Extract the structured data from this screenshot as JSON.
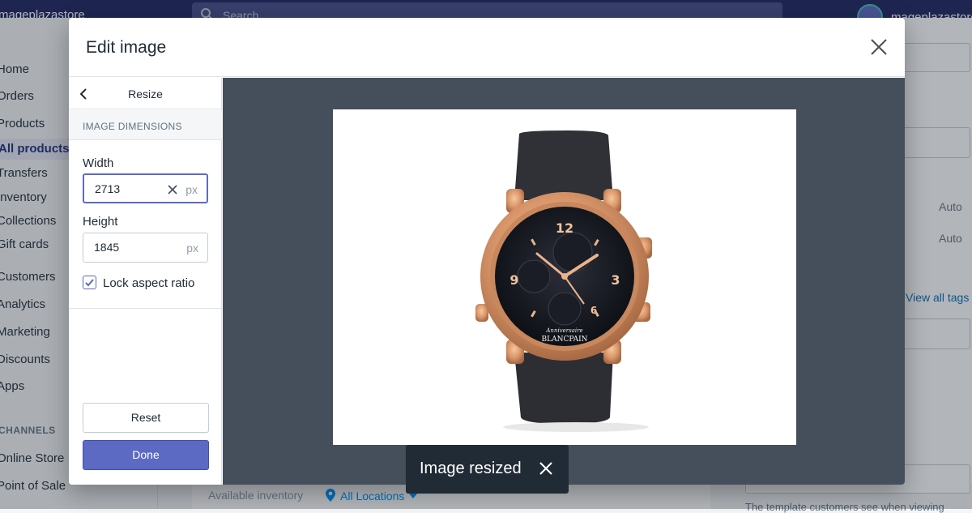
{
  "app": {
    "store_name": "mageplazastore",
    "search_placeholder": "Search",
    "profile_name": "mageplazastore"
  },
  "sidebar": {
    "items": [
      {
        "label": "Home"
      },
      {
        "label": "Orders"
      },
      {
        "label": "Products"
      },
      {
        "label": "All products"
      },
      {
        "label": "Transfers"
      },
      {
        "label": "Inventory"
      },
      {
        "label": "Collections"
      },
      {
        "label": "Gift cards"
      },
      {
        "label": "Customers"
      },
      {
        "label": "Analytics"
      },
      {
        "label": "Marketing"
      },
      {
        "label": "Discounts"
      },
      {
        "label": "Apps"
      }
    ],
    "channels_heading": "CHANNELS",
    "channels": [
      {
        "label": "Online Store"
      },
      {
        "label": "Point of Sale"
      }
    ]
  },
  "background": {
    "auto_1": "Auto",
    "auto_2": "Auto",
    "view_all_tags": "View all tags",
    "available_inventory": "Available inventory",
    "all_locations": "All Locations",
    "template_text": "The template customers see when viewing"
  },
  "modal": {
    "title": "Edit image",
    "panel_title": "Resize",
    "section_heading": "IMAGE DIMENSIONS",
    "width_label": "Width",
    "width_value": "2713",
    "height_label": "Height",
    "height_value": "1845",
    "unit": "px",
    "lock_label": "Lock aspect ratio",
    "lock_checked": true,
    "reset_label": "Reset",
    "done_label": "Done"
  },
  "watch": {
    "brand": "BLANCPAIN",
    "sub": "Anniversaire"
  },
  "toast": {
    "message": "Image resized"
  },
  "colors": {
    "primary": "#5c6ac4",
    "topbar": "#1c2260",
    "canvas": "#454f5b"
  }
}
